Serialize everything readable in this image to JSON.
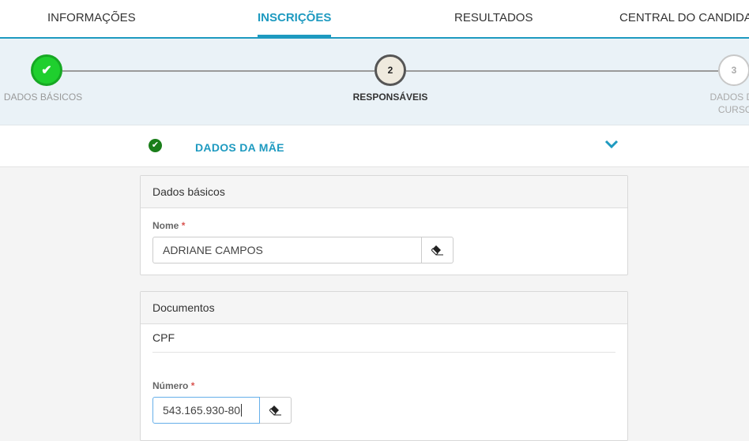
{
  "nav": {
    "tabs": [
      {
        "label": "INFORMAÇÕES"
      },
      {
        "label": "INSCRIÇÕES"
      },
      {
        "label": "RESULTADOS"
      },
      {
        "label": "CENTRAL DO CANDIDATO"
      }
    ],
    "active_tab": "INSCRIÇÕES"
  },
  "stepper": {
    "steps": [
      {
        "number": "✔",
        "label": "DADOS BÁSICOS",
        "state": "completed"
      },
      {
        "number": "2",
        "label": "RESPONSÁVEIS",
        "state": "current"
      },
      {
        "number": "3",
        "label": "DADOS DO CURSO",
        "state": "pending"
      }
    ]
  },
  "section": {
    "title": "DADOS DA MÃE",
    "status_icon": "check-circle-icon",
    "toggle_icon": "chevron-down-icon"
  },
  "panel_basic": {
    "header": "Dados básicos",
    "name_label": "Nome",
    "required_mark": "*",
    "name_value": "ADRIANE  CAMPOS",
    "clear_icon": "eraser-icon"
  },
  "panel_docs": {
    "header": "Documentos",
    "subheader": "CPF",
    "number_label": "Número",
    "required_mark": "*",
    "number_value": "543.165.930-80",
    "clear_icon": "eraser-icon"
  },
  "colors": {
    "accent": "#1e9ac0",
    "success": "#1fcf2e",
    "required": "#d9534f"
  }
}
